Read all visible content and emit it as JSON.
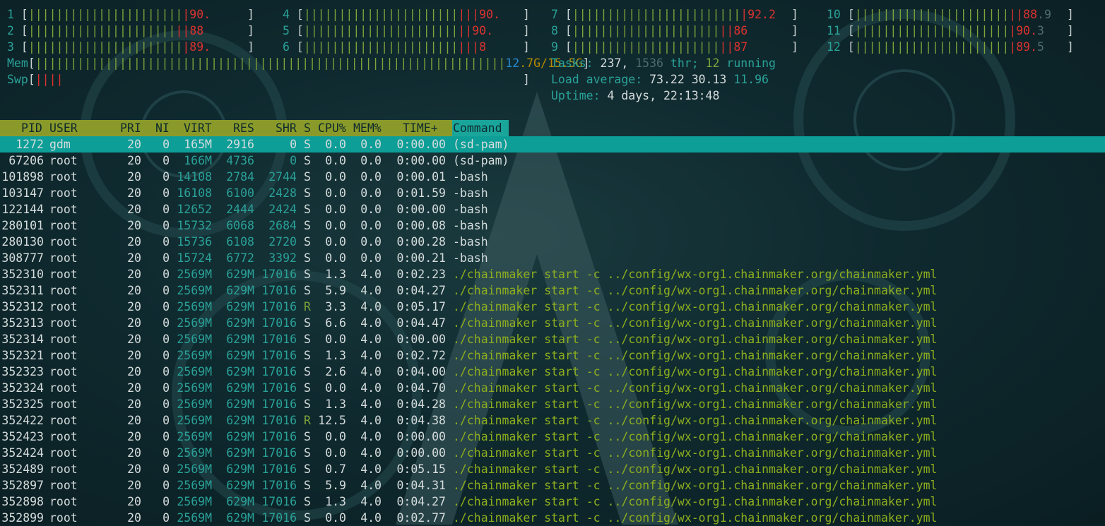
{
  "cpus": [
    {
      "id": "1",
      "bar": "||||||||||||||||||||||",
      "red": "|",
      "val": "90."
    },
    {
      "id": "2",
      "bar": "|||||||||||||||||||||",
      "red": "||",
      "val": "88"
    },
    {
      "id": "3",
      "bar": "||||||||||||||||||||||",
      "red": "|",
      "val": "89."
    },
    {
      "id": "4",
      "bar": "||||||||||||||||||||||",
      "red": "|||",
      "val": "90."
    },
    {
      "id": "5",
      "bar": "||||||||||||||||||||||",
      "red": "||",
      "val": "90."
    },
    {
      "id": "6",
      "bar": "||||||||||||||||||||||",
      "red": "|||",
      "val": "8"
    },
    {
      "id": "7",
      "bar": "||||||||||||||||||||||||",
      "red": "|",
      "val": "92.2"
    },
    {
      "id": "8",
      "bar": "|||||||||||||||||||||",
      "red": "||",
      "val": "86"
    },
    {
      "id": "9",
      "bar": "|||||||||||||||||||||",
      "red": "||",
      "val": "87"
    },
    {
      "id": "10",
      "bar": "||||||||||||||||||||||",
      "red": "||",
      "val": "88",
      "tail": ".9"
    },
    {
      "id": "11",
      "bar": "||||||||||||||||||||||",
      "red": "|",
      "val": "90.",
      "tail": "3"
    },
    {
      "id": "12",
      "bar": "||||||||||||||||||||||",
      "red": "|",
      "val": "89.",
      "tail": "5"
    }
  ],
  "mem": {
    "label": "Mem",
    "bar": "|||||||||||||||||||||||||||||||||||||||||||||||||||||||||||||||||||",
    "used": "12",
    "rest": ".7G/15.5G"
  },
  "swp": {
    "label": "Swp",
    "bar": "||||"
  },
  "tasks": {
    "label": "Tasks:",
    "count": "237,",
    "thr": "1536",
    "thr_label": "thr;",
    "running": "12",
    "running_label": "running"
  },
  "load": {
    "label": "Load average:",
    "v1": "73.22",
    "v2": "30.13",
    "v3": "11.96"
  },
  "uptime": {
    "label": "Uptime:",
    "value": "4 days, 22:13:48"
  },
  "columns": {
    "pid": "PID",
    "user": "USER",
    "pri": "PRI",
    "ni": "NI",
    "virt": "VIRT",
    "res": "RES",
    "shr": "SHR",
    "s": "S",
    "cpu": "CPU%",
    "mem": "MEM%",
    "time": "TIME+",
    "command": "Command"
  },
  "processes": [
    {
      "pid": "1272",
      "user": "gdm",
      "pri": "20",
      "ni": "0",
      "virt": "165M",
      "res": "2916",
      "shr": "0",
      "s": "S",
      "cpu": "0.0",
      "mem": "0.0",
      "time": "0:00.00",
      "cmd": "(sd-pam)"
    },
    {
      "pid": "67206",
      "user": "root",
      "pri": "20",
      "ni": "0",
      "virt": "166M",
      "res": "4736",
      "shr": "0",
      "s": "S",
      "cpu": "0.0",
      "mem": "0.0",
      "time": "0:00.00",
      "cmd": "(sd-pam)"
    },
    {
      "pid": "101898",
      "user": "root",
      "pri": "20",
      "ni": "0",
      "virt": "14108",
      "res": "2784",
      "shr": "2744",
      "s": "S",
      "cpu": "0.0",
      "mem": "0.0",
      "time": "0:00.01",
      "cmd": "-bash"
    },
    {
      "pid": "103147",
      "user": "root",
      "pri": "20",
      "ni": "0",
      "virt": "16108",
      "res": "6100",
      "shr": "2428",
      "s": "S",
      "cpu": "0.0",
      "mem": "0.0",
      "time": "0:01.59",
      "cmd": "-bash"
    },
    {
      "pid": "122144",
      "user": "root",
      "pri": "20",
      "ni": "0",
      "virt": "12652",
      "res": "2444",
      "shr": "2424",
      "s": "S",
      "cpu": "0.0",
      "mem": "0.0",
      "time": "0:00.00",
      "cmd": "-bash"
    },
    {
      "pid": "280101",
      "user": "root",
      "pri": "20",
      "ni": "0",
      "virt": "15732",
      "res": "6068",
      "shr": "2684",
      "s": "S",
      "cpu": "0.0",
      "mem": "0.0",
      "time": "0:00.08",
      "cmd": "-bash"
    },
    {
      "pid": "280130",
      "user": "root",
      "pri": "20",
      "ni": "0",
      "virt": "15736",
      "res": "6108",
      "shr": "2720",
      "s": "S",
      "cpu": "0.0",
      "mem": "0.0",
      "time": "0:00.28",
      "cmd": "-bash"
    },
    {
      "pid": "308777",
      "user": "root",
      "pri": "20",
      "ni": "0",
      "virt": "15724",
      "res": "6772",
      "shr": "3392",
      "s": "S",
      "cpu": "0.0",
      "mem": "0.0",
      "time": "0:00.21",
      "cmd": "-bash"
    },
    {
      "pid": "352310",
      "user": "root",
      "pri": "20",
      "ni": "0",
      "virt": "2569M",
      "res": "629M",
      "shr": "17016",
      "s": "S",
      "cpu": "1.3",
      "mem": "4.0",
      "time": "0:02.23",
      "cmd": "./chainmaker start -c ../config/wx-org1.chainmaker.org/chainmaker.yml"
    },
    {
      "pid": "352311",
      "user": "root",
      "pri": "20",
      "ni": "0",
      "virt": "2569M",
      "res": "629M",
      "shr": "17016",
      "s": "S",
      "cpu": "5.9",
      "mem": "4.0",
      "time": "0:04.27",
      "cmd": "./chainmaker start -c ../config/wx-org1.chainmaker.org/chainmaker.yml"
    },
    {
      "pid": "352312",
      "user": "root",
      "pri": "20",
      "ni": "0",
      "virt": "2569M",
      "res": "629M",
      "shr": "17016",
      "s": "R",
      "cpu": "3.3",
      "mem": "4.0",
      "time": "0:05.17",
      "cmd": "./chainmaker start -c ../config/wx-org1.chainmaker.org/chainmaker.yml"
    },
    {
      "pid": "352313",
      "user": "root",
      "pri": "20",
      "ni": "0",
      "virt": "2569M",
      "res": "629M",
      "shr": "17016",
      "s": "S",
      "cpu": "6.6",
      "mem": "4.0",
      "time": "0:04.47",
      "cmd": "./chainmaker start -c ../config/wx-org1.chainmaker.org/chainmaker.yml"
    },
    {
      "pid": "352314",
      "user": "root",
      "pri": "20",
      "ni": "0",
      "virt": "2569M",
      "res": "629M",
      "shr": "17016",
      "s": "S",
      "cpu": "0.0",
      "mem": "4.0",
      "time": "0:00.00",
      "cmd": "./chainmaker start -c ../config/wx-org1.chainmaker.org/chainmaker.yml"
    },
    {
      "pid": "352321",
      "user": "root",
      "pri": "20",
      "ni": "0",
      "virt": "2569M",
      "res": "629M",
      "shr": "17016",
      "s": "S",
      "cpu": "1.3",
      "mem": "4.0",
      "time": "0:02.72",
      "cmd": "./chainmaker start -c ../config/wx-org1.chainmaker.org/chainmaker.yml"
    },
    {
      "pid": "352323",
      "user": "root",
      "pri": "20",
      "ni": "0",
      "virt": "2569M",
      "res": "629M",
      "shr": "17016",
      "s": "S",
      "cpu": "2.6",
      "mem": "4.0",
      "time": "0:04.00",
      "cmd": "./chainmaker start -c ../config/wx-org1.chainmaker.org/chainmaker.yml"
    },
    {
      "pid": "352324",
      "user": "root",
      "pri": "20",
      "ni": "0",
      "virt": "2569M",
      "res": "629M",
      "shr": "17016",
      "s": "S",
      "cpu": "0.0",
      "mem": "4.0",
      "time": "0:04.70",
      "cmd": "./chainmaker start -c ../config/wx-org1.chainmaker.org/chainmaker.yml"
    },
    {
      "pid": "352325",
      "user": "root",
      "pri": "20",
      "ni": "0",
      "virt": "2569M",
      "res": "629M",
      "shr": "17016",
      "s": "S",
      "cpu": "1.3",
      "mem": "4.0",
      "time": "0:04.28",
      "cmd": "./chainmaker start -c ../config/wx-org1.chainmaker.org/chainmaker.yml"
    },
    {
      "pid": "352422",
      "user": "root",
      "pri": "20",
      "ni": "0",
      "virt": "2569M",
      "res": "629M",
      "shr": "17016",
      "s": "R",
      "cpu": "12.5",
      "mem": "4.0",
      "time": "0:04.38",
      "cmd": "./chainmaker start -c ../config/wx-org1.chainmaker.org/chainmaker.yml"
    },
    {
      "pid": "352423",
      "user": "root",
      "pri": "20",
      "ni": "0",
      "virt": "2569M",
      "res": "629M",
      "shr": "17016",
      "s": "S",
      "cpu": "0.0",
      "mem": "4.0",
      "time": "0:00.00",
      "cmd": "./chainmaker start -c ../config/wx-org1.chainmaker.org/chainmaker.yml"
    },
    {
      "pid": "352424",
      "user": "root",
      "pri": "20",
      "ni": "0",
      "virt": "2569M",
      "res": "629M",
      "shr": "17016",
      "s": "S",
      "cpu": "0.0",
      "mem": "4.0",
      "time": "0:00.00",
      "cmd": "./chainmaker start -c ../config/wx-org1.chainmaker.org/chainmaker.yml"
    },
    {
      "pid": "352489",
      "user": "root",
      "pri": "20",
      "ni": "0",
      "virt": "2569M",
      "res": "629M",
      "shr": "17016",
      "s": "S",
      "cpu": "0.7",
      "mem": "4.0",
      "time": "0:05.15",
      "cmd": "./chainmaker start -c ../config/wx-org1.chainmaker.org/chainmaker.yml"
    },
    {
      "pid": "352897",
      "user": "root",
      "pri": "20",
      "ni": "0",
      "virt": "2569M",
      "res": "629M",
      "shr": "17016",
      "s": "S",
      "cpu": "5.9",
      "mem": "4.0",
      "time": "0:04.31",
      "cmd": "./chainmaker start -c ../config/wx-org1.chainmaker.org/chainmaker.yml"
    },
    {
      "pid": "352898",
      "user": "root",
      "pri": "20",
      "ni": "0",
      "virt": "2569M",
      "res": "629M",
      "shr": "17016",
      "s": "S",
      "cpu": "1.3",
      "mem": "4.0",
      "time": "0:04.27",
      "cmd": "./chainmaker start -c ../config/wx-org1.chainmaker.org/chainmaker.yml"
    },
    {
      "pid": "352899",
      "user": "root",
      "pri": "20",
      "ni": "0",
      "virt": "2569M",
      "res": "629M",
      "shr": "17016",
      "s": "S",
      "cpu": "0.0",
      "mem": "4.0",
      "time": "0:02.77",
      "cmd": "./chainmaker start -c ../config/wx-org1.chainmaker.org/chainmaker.yml"
    }
  ]
}
